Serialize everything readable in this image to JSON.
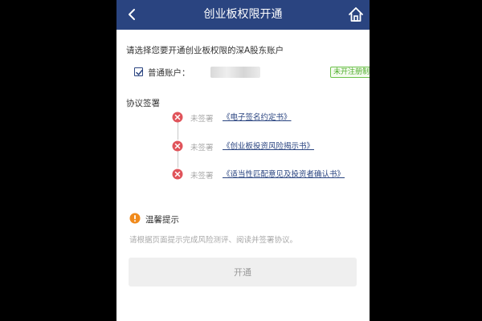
{
  "header": {
    "title": "创业板权限开通",
    "back_icon": "chevron-left-icon",
    "home_icon": "home-icon",
    "bar_color": "#2a4480"
  },
  "account_section": {
    "prompt": "请选择您要开通创业板权限的深A股东账户",
    "account_label": "普通账户：",
    "account_checked": true,
    "status_badge": "未开注册制"
  },
  "agreements": {
    "title": "协议签署",
    "items": [
      {
        "status": "未签署",
        "name": "《电子签名约定书》"
      },
      {
        "status": "未签署",
        "name": "《创业板投资风险揭示书》"
      },
      {
        "status": "未签署",
        "name": "《适当性匹配意见及投资者确认书》"
      }
    ],
    "status_color": "#e0535a"
  },
  "tips": {
    "title": "温馨提示",
    "body": "请根据页面提示完成风险测评、阅读并签署协议。",
    "icon_color": "#f08a1c"
  },
  "action": {
    "button_label": "开通"
  }
}
